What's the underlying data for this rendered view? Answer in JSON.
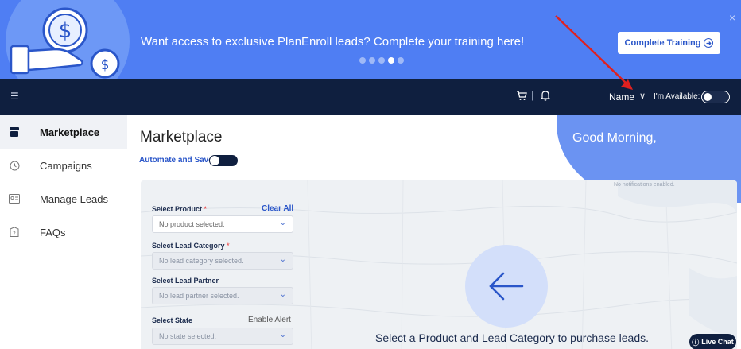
{
  "banner": {
    "message": "Want access to exclusive PlanEnroll leads? Complete your training here!",
    "button_label": "Complete Training",
    "button_icon": "arrow-right-circle-icon",
    "close_icon": "×",
    "carousel_count": 5,
    "carousel_active": 4
  },
  "topnav": {
    "menu_icon": "☰",
    "separator": "|",
    "user_name": "Name",
    "user_chevron": "∨",
    "availability_label": "I'm Available:",
    "availability_on": false
  },
  "sidebar": {
    "items": [
      {
        "label": "Marketplace",
        "icon": "store-icon",
        "active": true
      },
      {
        "label": "Campaigns",
        "icon": "clock-icon",
        "active": false
      },
      {
        "label": "Manage Leads",
        "icon": "contact-card-icon",
        "active": false
      },
      {
        "label": "FAQs",
        "icon": "faq-icon",
        "active": false
      }
    ]
  },
  "main": {
    "title": "Marketplace",
    "greeting": "Good Morning,",
    "automate_label": "Automate and Save:",
    "notifications_text": "No notifications enabled.",
    "filters": {
      "clear_all": "Clear All",
      "enable_alert": "Enable Alert",
      "product": {
        "label": "Select Product",
        "required": "*",
        "value": "No product selected."
      },
      "lead_category": {
        "label": "Select Lead Category",
        "required": "*",
        "value": "No lead category selected."
      },
      "lead_partner": {
        "label": "Select Lead Partner",
        "value": "No lead partner selected."
      },
      "state": {
        "label": "Select State",
        "value": "No state selected."
      }
    },
    "prompt": "Select a Product and Lead Category to purchase leads.",
    "live_chat": "Live Chat"
  },
  "colors": {
    "banner_blue": "#4f7ef3",
    "nav_navy": "#0f1f3f",
    "accent_blue": "#2a56c9",
    "annotation_red": "#e0201f"
  }
}
